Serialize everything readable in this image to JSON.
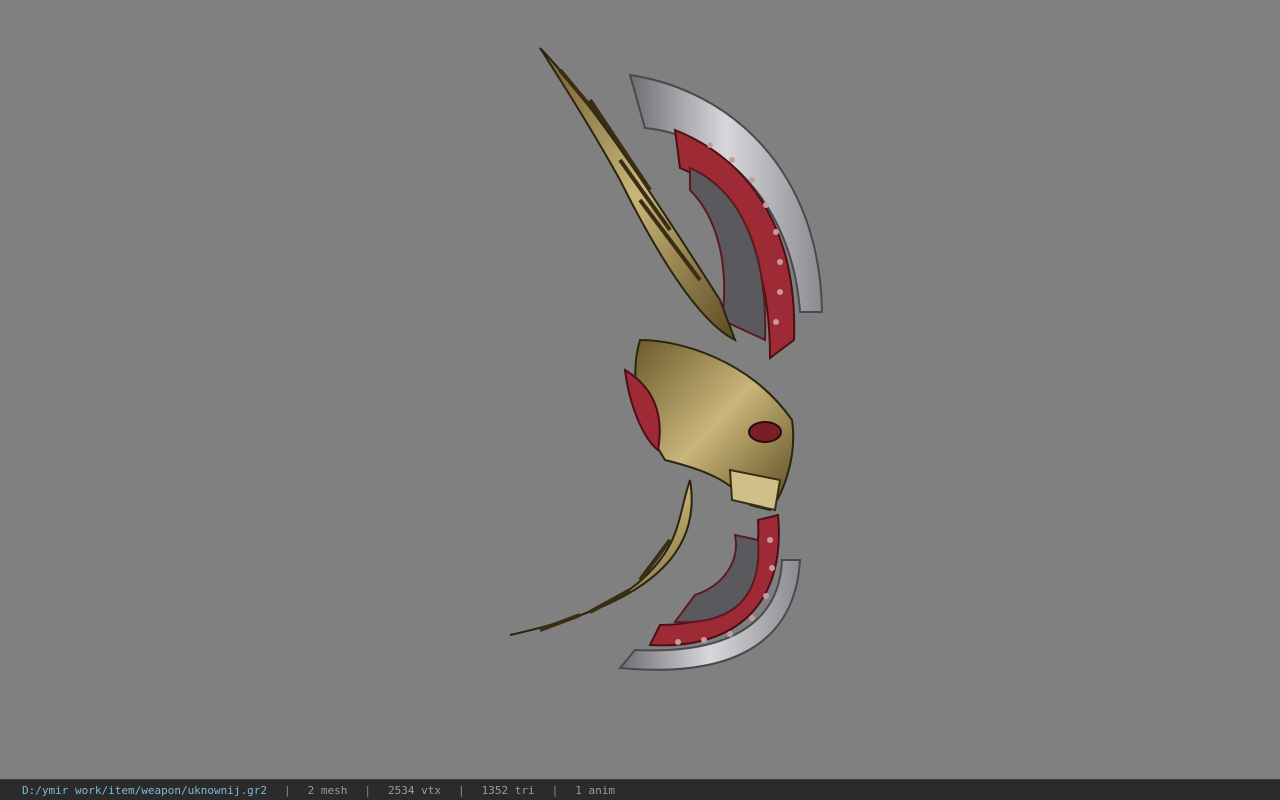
{
  "viewer": {
    "background_color": "#808080",
    "model_icon": "ornate-double-blade-weapon"
  },
  "status": {
    "file_path": "D:/ymir work/item/weapon/uknownij.gr2",
    "separator": "|",
    "mesh": "2 mesh",
    "vertices": "2534 vtx",
    "triangles": "1352 tri",
    "animations": "1 anim"
  }
}
